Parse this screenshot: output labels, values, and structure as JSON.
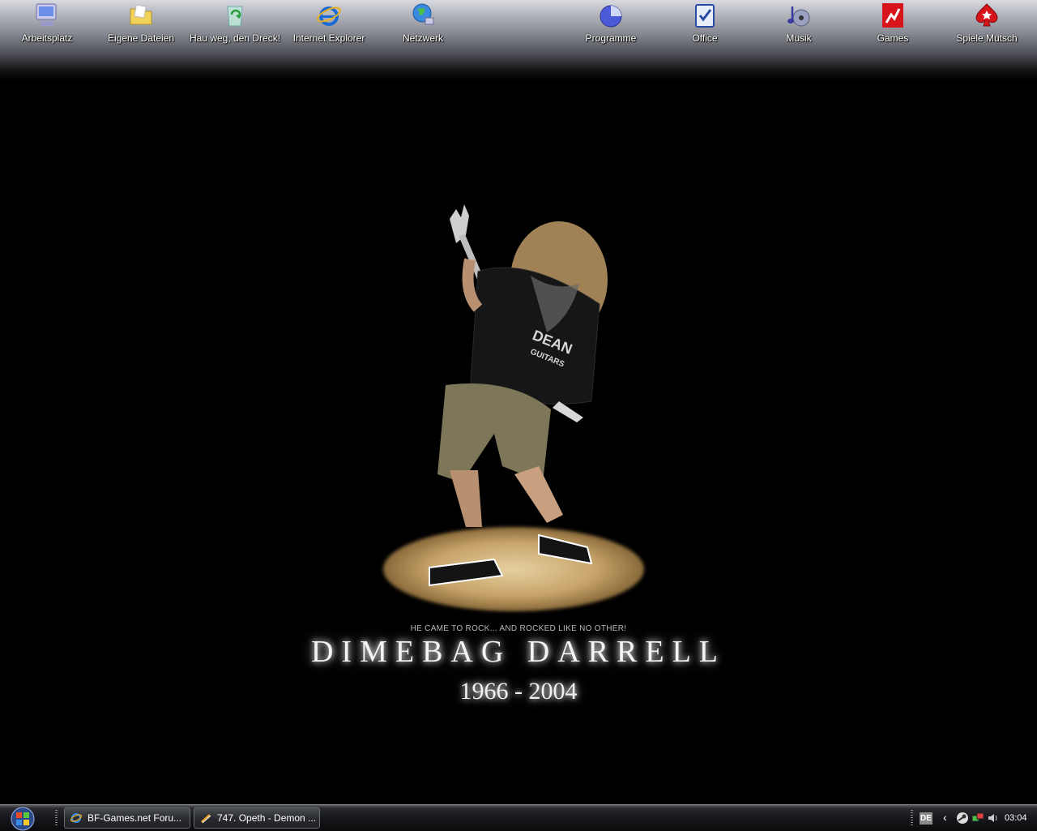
{
  "desktop_icons": [
    {
      "label": "Arbeitsplatz",
      "icon": "computer-icon"
    },
    {
      "label": "Eigene Dateien",
      "icon": "folder-icon"
    },
    {
      "label": "Hau weg, den Dreck!",
      "icon": "recycle-bin-icon"
    },
    {
      "label": "Internet Explorer",
      "icon": "internet-explorer-icon"
    },
    {
      "label": "Netzwerk",
      "icon": "network-globe-icon"
    },
    {
      "label": "Programme",
      "icon": "pie-chart-icon"
    },
    {
      "label": "Office",
      "icon": "office-clipboard-icon"
    },
    {
      "label": "Musik",
      "icon": "music-note-icon"
    },
    {
      "label": "Games",
      "icon": "games-icon"
    },
    {
      "label": "Spiele Mutsch",
      "icon": "poker-spade-icon"
    }
  ],
  "wallpaper": {
    "tagline": "HE CAME TO ROCK... AND ROCKED LIKE NO OTHER!",
    "name": "DIMEBAG DARRELL",
    "years": "1966 - 2004",
    "shirt_text_1": "DEAN",
    "shirt_text_2": "GUITARS"
  },
  "taskbar": {
    "tasks": [
      {
        "label": "BF-Games.net Foru...",
        "icon": "internet-explorer-icon"
      },
      {
        "label": "747. Opeth - Demon ...",
        "icon": "media-player-icon"
      }
    ],
    "language": "DE",
    "clock": "03:04",
    "tray_icons": [
      "steam-icon",
      "network-icon",
      "speaker-icon"
    ]
  },
  "colors": {
    "accent": "#1a6ad6",
    "games_red": "#d8141b",
    "desktop_bg": "#000000"
  }
}
